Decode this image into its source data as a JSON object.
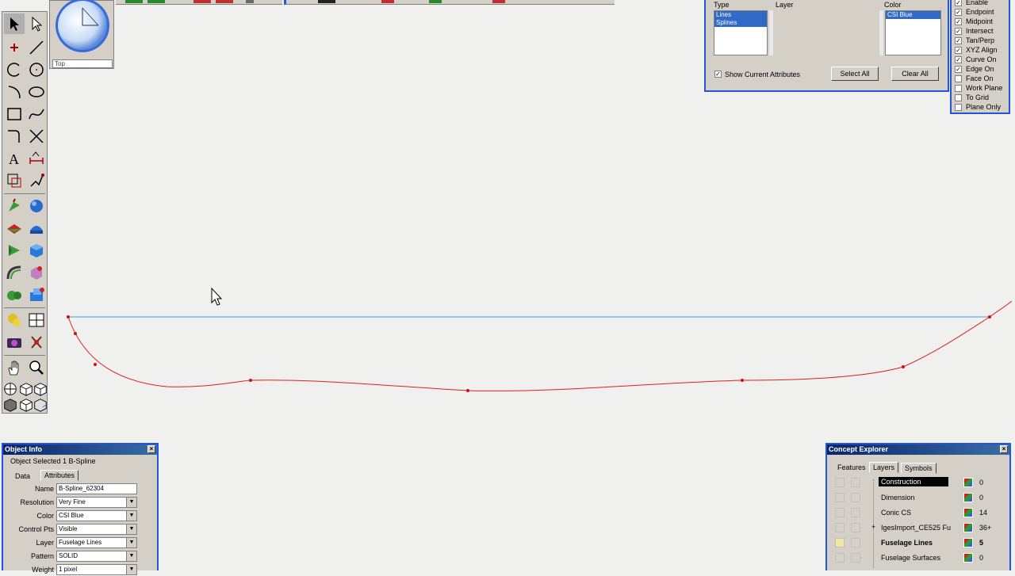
{
  "view": {
    "label": "Top"
  },
  "filter_panel": {
    "type_label": "Type",
    "layer_label": "Layer",
    "color_label": "Color",
    "type_items": [
      "Lines",
      "Splines"
    ],
    "color_items": [
      "CSI Blue"
    ],
    "show_current_label": "Show Current Attributes",
    "select_all_label": "Select All",
    "clear_all_label": "Clear All"
  },
  "snap_panel": {
    "items": [
      {
        "label": "Enable",
        "checked": true
      },
      {
        "label": "Endpoint",
        "checked": true
      },
      {
        "label": "Midpoint",
        "checked": true
      },
      {
        "label": "Intersect",
        "checked": true
      },
      {
        "label": "Tan/Perp",
        "checked": true
      },
      {
        "label": "XYZ Align",
        "checked": true
      },
      {
        "label": "Curve On",
        "checked": true
      },
      {
        "label": "Edge On",
        "checked": true
      },
      {
        "label": "Face On",
        "checked": false
      },
      {
        "label": "Work Plane",
        "checked": false
      },
      {
        "label": "To Grid",
        "checked": false
      },
      {
        "label": "Plane Only",
        "checked": false
      }
    ]
  },
  "object_info": {
    "title": "Object Info",
    "status": "Object Selected 1 B-Spline",
    "tabs": [
      "Data",
      "Attributes"
    ],
    "fields": [
      {
        "label": "Name",
        "value": "B-Spline_62304"
      },
      {
        "label": "Resolution",
        "value": "Very Fine"
      },
      {
        "label": "Color",
        "value": "CSI Blue"
      },
      {
        "label": "Control Pts",
        "value": "Visible"
      },
      {
        "label": "Layer",
        "value": "Fuselage Lines"
      },
      {
        "label": "Pattern",
        "value": "SOLID"
      },
      {
        "label": "Weight",
        "value": "1 pixel"
      }
    ]
  },
  "explorer": {
    "title": "Concept Explorer",
    "tabs": [
      "Features",
      "Layers",
      "Symbols"
    ],
    "layers": [
      {
        "name": "Construction",
        "count": "0"
      },
      {
        "name": "Dimension",
        "count": "0"
      },
      {
        "name": "Conic CS",
        "count": "14"
      },
      {
        "name": "IgesImport_CE525 Fu",
        "count": "36+"
      },
      {
        "name": "Fuselage Lines",
        "count": "5"
      },
      {
        "name": "Fuselage Surfaces",
        "count": "0"
      }
    ]
  },
  "colors": {
    "spline": "#e02020",
    "line": "#4aa0e0",
    "panel_border": "#2255dd",
    "selection": "#3169c6"
  }
}
